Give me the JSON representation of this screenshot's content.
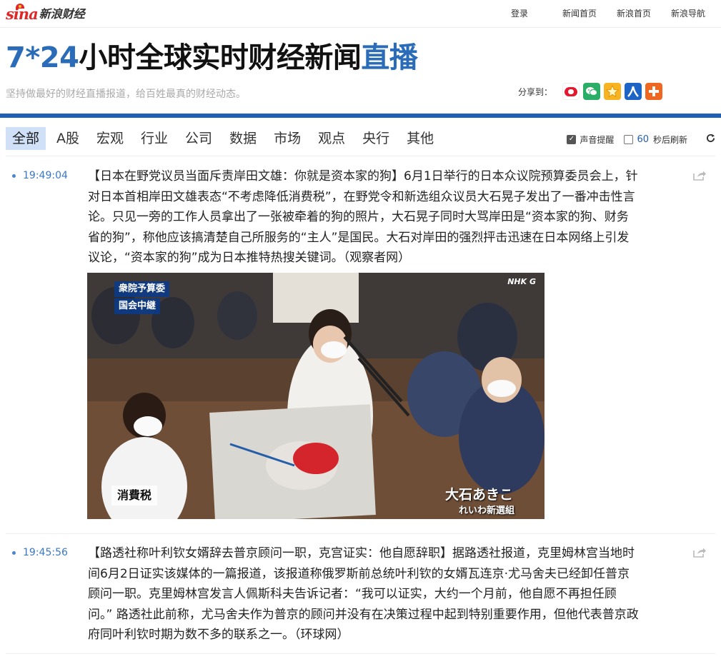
{
  "header": {
    "logo_text": "sina",
    "logo_sub": "新浪财经",
    "links": [
      "登录",
      "新闻首页",
      "新浪首页",
      "新浪导航"
    ]
  },
  "hero": {
    "title_part1": "7*24",
    "title_part2": "小时全球实时财经新闻",
    "title_part3": "直播",
    "subtitle": "坚持做最好的财经直播报道，给百姓最真的财经动态。",
    "share_label": "分享到：",
    "share_icons": [
      "weibo-icon",
      "wechat-icon",
      "qzone-icon",
      "renren-icon",
      "more-share-icon"
    ]
  },
  "tabs": [
    "全部",
    "A股",
    "宏观",
    "行业",
    "公司",
    "数据",
    "市场",
    "观点",
    "央行",
    "其他"
  ],
  "active_tab": 0,
  "options": {
    "sound_label": "声音提醒",
    "sound_on": true,
    "refresh_checked": false,
    "refresh_seconds": "60",
    "refresh_label": "秒后刷新",
    "refresh_icon": "refresh-icon"
  },
  "feed": [
    {
      "time": "19:49:04",
      "text": "【日本在野党议员当面斥责岸田文雄：你就是资本家的狗】6月1日举行的日本众议院预算委员会上，针对日本首相岸田文雄表态“不考虑降低消费税”，在野党令和新选组众议员大石晃子发出了一番冲击性言论。只见一旁的工作人员拿出了一张被牵着的狗的照片，大石晃子同时大骂岸田是“资本家的狗、财务省的狗”，称他应该搞清楚自己所服务的“主人”是国民。大石对岸田的强烈抨击迅速在日本网络上引发议论，“资本家的狗”成为日本推特热搜关键词。（观察者网）",
      "image": {
        "watermark": "NHK G",
        "caption_top1": "衆院予算委",
        "caption_top2": "国会中継",
        "caption_sign": "消費税",
        "caption_name": "大石あきこ",
        "caption_party": "れいわ新選組"
      }
    },
    {
      "time": "19:45:56",
      "text": "【路透社称叶利钦女婿辞去普京顾问一职，克宫证实：他自愿辞职】据路透社报道，克里姆林宫当地时间6月2日证实该媒体的一篇报道，该报道称俄罗斯前总统叶利钦的女婿瓦连京·尤马舍夫已经卸任普京顾问一职。克里姆林宫发言人佩斯科夫告诉记者：“我可以证实，大约一个月前，他自愿不再担任顾问。” 路透社此前称，尤马舍夫作为普京的顾问并没有在决策过程中起到特别重要作用，但他代表普京政府同叶利钦时期为数不多的联系之一。（环球网）"
    }
  ]
}
